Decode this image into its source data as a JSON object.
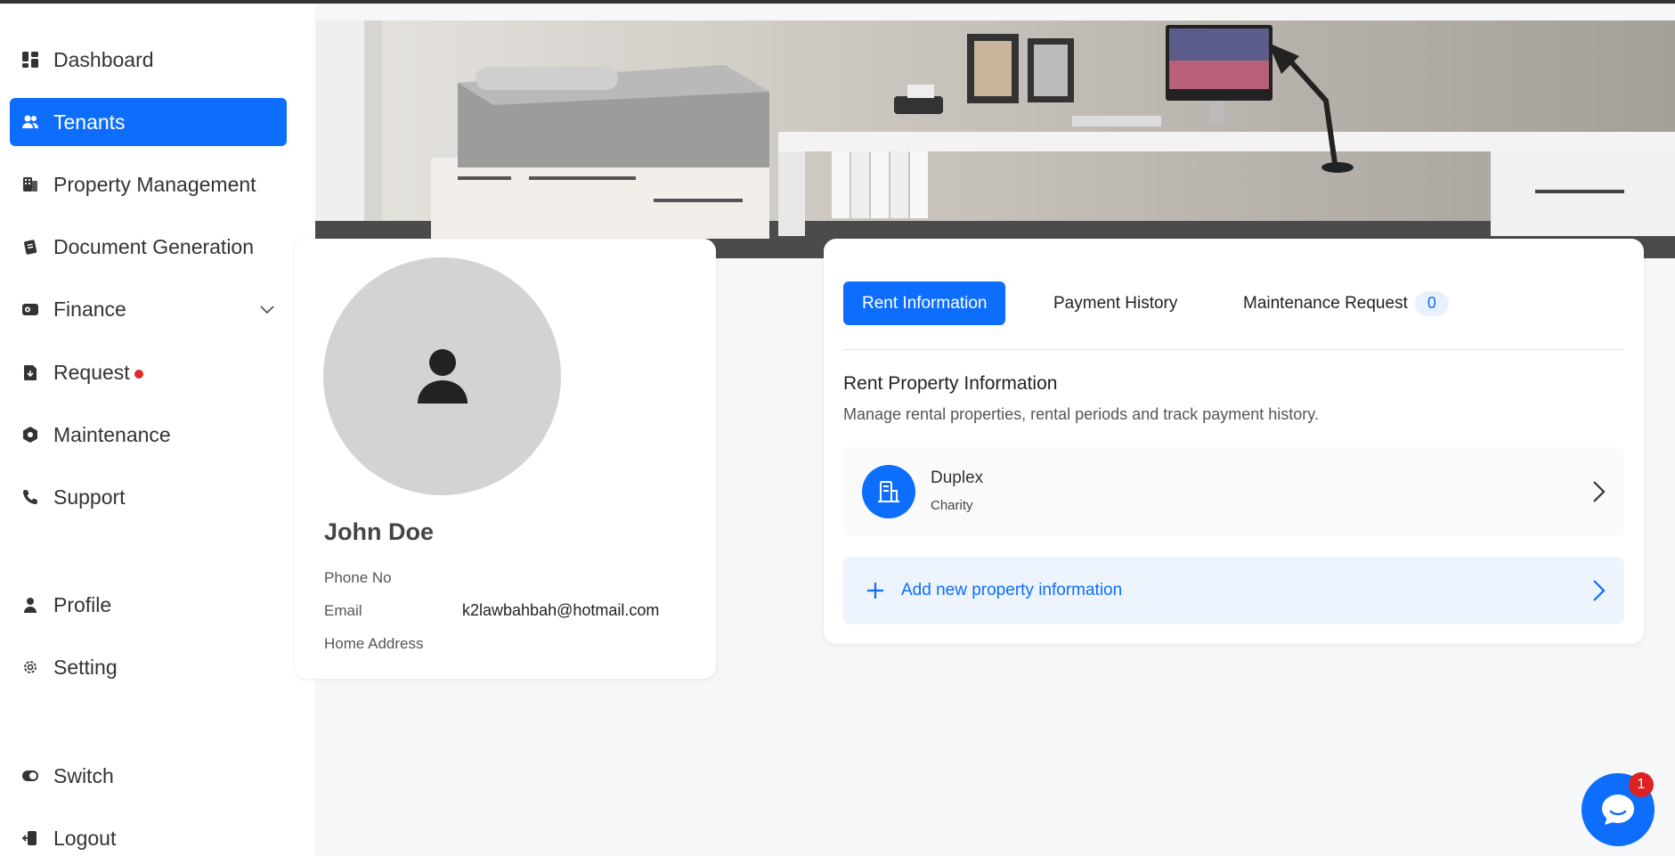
{
  "sidebar": {
    "items": [
      {
        "label": "Dashboard",
        "icon": "dashboard-icon"
      },
      {
        "label": "Tenants",
        "icon": "users-icon",
        "active": true
      },
      {
        "label": "Property Management",
        "icon": "building-icon"
      },
      {
        "label": "Document Generation",
        "icon": "document-icon"
      },
      {
        "label": "Finance",
        "icon": "wallet-icon",
        "expandable": true
      },
      {
        "label": "Request",
        "icon": "request-icon",
        "has_notification": true
      },
      {
        "label": "Maintenance",
        "icon": "wrench-hex-icon"
      },
      {
        "label": "Support",
        "icon": "phone-icon"
      },
      {
        "label": "Profile",
        "icon": "user-icon"
      },
      {
        "label": "Setting",
        "icon": "gear-icon"
      },
      {
        "label": "Switch",
        "icon": "switch-icon"
      },
      {
        "label": "Logout",
        "icon": "logout-icon"
      }
    ]
  },
  "profile": {
    "name": "John Doe",
    "phone_label": "Phone No",
    "phone_value": "",
    "email_label": "Email",
    "email_value": "k2lawbahbah@hotmail.com",
    "address_label": "Home Address",
    "address_value": ""
  },
  "tabs": [
    {
      "label": "Rent Information",
      "active": true
    },
    {
      "label": "Payment History"
    },
    {
      "label": "Maintenance Request",
      "badge": "0"
    }
  ],
  "rent": {
    "title": "Rent Property Information",
    "description": "Manage rental properties, rental periods and track payment history.",
    "property": {
      "name": "Duplex",
      "subtitle": "Charity"
    },
    "add_label": "Add new property information"
  },
  "chat": {
    "badge": "1"
  },
  "colors": {
    "accent": "#0d6efd",
    "notification": "#e0282e"
  }
}
